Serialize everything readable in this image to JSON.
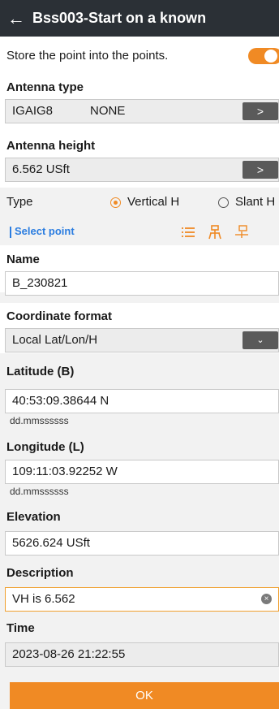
{
  "header": {
    "title": "Bss003-Start on a known"
  },
  "store_point": {
    "label": "Store the point into the points.",
    "enabled": true
  },
  "antenna_type": {
    "label": "Antenna type",
    "value": "IGAIG8",
    "radome": "NONE"
  },
  "antenna_height": {
    "label": "Antenna height",
    "value": "6.562 USft"
  },
  "type": {
    "label": "Type",
    "options": [
      "Vertical H",
      "Slant H"
    ],
    "selected": "Vertical H"
  },
  "select_point": {
    "label": "Select point"
  },
  "name": {
    "label": "Name",
    "value": "B_230821"
  },
  "coord_format": {
    "label": "Coordinate format",
    "value": "Local Lat/Lon/H"
  },
  "latitude": {
    "label": "Latitude (B)",
    "value": "40:53:09.38644 N",
    "format": "dd.mmssssss"
  },
  "longitude": {
    "label": "Longitude (L)",
    "value": "109:11:03.92252 W",
    "format": "dd.mmssssss"
  },
  "elevation": {
    "label": "Elevation",
    "value": "5626.624 USft"
  },
  "description": {
    "label": "Description",
    "value": "VH is 6.562"
  },
  "time": {
    "label": "Time",
    "value": "2023-08-26 21:22:55"
  },
  "ok_button": {
    "label": "OK"
  },
  "colors": {
    "accent": "#f08a24",
    "header_bg": "#2b3036",
    "link": "#2b7de0"
  }
}
